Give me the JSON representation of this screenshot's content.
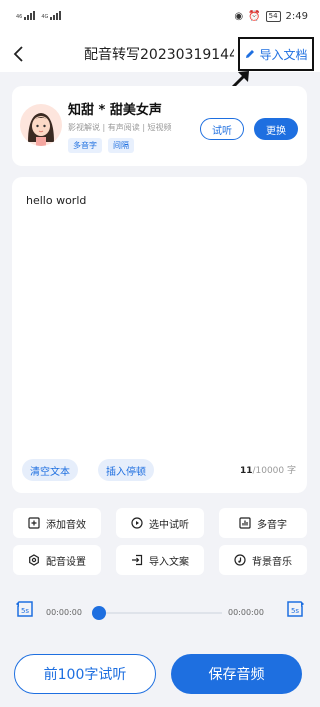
{
  "status_bar": {
    "time": "2:49",
    "battery": "54",
    "sim1": "46",
    "sim2": "4G"
  },
  "header": {
    "title": "配音转写20230319144...",
    "import_label": "导入文档"
  },
  "voice": {
    "name": "知甜 * 甜美女声",
    "description": "影视解说 | 有声阅读 | 短视频",
    "tags": [
      "多音字",
      "间隔"
    ],
    "audition_label": "试听",
    "change_label": "更换"
  },
  "editor": {
    "text": "hello world",
    "clear_label": "清空文本",
    "insert_pause_label": "插入停顿",
    "char_count": "11",
    "char_limit": "/10000 字"
  },
  "tools": [
    {
      "label": "添加音效",
      "icon": "plus-box-icon"
    },
    {
      "label": "选中试听",
      "icon": "play-circle-icon"
    },
    {
      "label": "多音字",
      "icon": "bars-icon"
    },
    {
      "label": "配音设置",
      "icon": "settings-icon"
    },
    {
      "label": "导入文案",
      "icon": "import-icon"
    },
    {
      "label": "背景音乐",
      "icon": "music-note-icon"
    }
  ],
  "player": {
    "current_time": "00:00:00",
    "total_time": "00:00:00",
    "rewind_label": "5s",
    "forward_label": "5s",
    "progress": 0
  },
  "actions": {
    "trial_label": "前100字试听",
    "save_label": "保存音频"
  },
  "colors": {
    "accent": "#1e6fe0",
    "background": "#f2f3f7"
  }
}
